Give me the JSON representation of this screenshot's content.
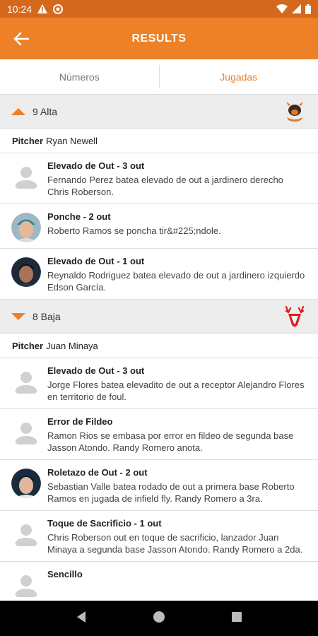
{
  "status": {
    "time": "10:24"
  },
  "app_bar": {
    "title": "RESULTS"
  },
  "tabs": [
    {
      "label": "Números",
      "active": false
    },
    {
      "label": "Jugadas",
      "active": true
    }
  ],
  "innings": [
    {
      "label": "9 Alta",
      "direction": "up",
      "pitcher_label": "Pitcher",
      "pitcher": "Ryan Newell",
      "plays": [
        {
          "title": "Elevado de Out - 3 out",
          "desc": "Fernando Perez batea elevado de out a jardinero derecho Chris Roberson.",
          "avatar": "placeholder"
        },
        {
          "title": "Ponche - 2 out",
          "desc": "Roberto Ramos se poncha tir&#225;ndole.",
          "avatar": "photo-teal"
        },
        {
          "title": "Elevado de Out - 1 out",
          "desc": "Reynaldo Rodriguez batea elevado de out a jardinero izquierdo Edson García.",
          "avatar": "photo-dark"
        }
      ]
    },
    {
      "label": "8 Baja",
      "direction": "down",
      "pitcher_label": "Pitcher",
      "pitcher": "Juan Minaya",
      "plays": [
        {
          "title": "Elevado de Out - 3 out",
          "desc": "Jorge Flores batea elevadito de out a receptor Alejandro Flores en territorio de foul.",
          "avatar": "placeholder"
        },
        {
          "title": "Error de Fildeo",
          "desc": "Ramon Rios se embasa por error en fildeo de segunda base Jasson Atondo.   Randy Romero anota.",
          "avatar": "placeholder"
        },
        {
          "title": "Roletazo de Out - 2 out",
          "desc": "Sebastian Valle batea rodado de out a primera base Roberto Ramos en jugada de infield fly.   Randy Romero a 3ra.",
          "avatar": "photo-navy"
        },
        {
          "title": "Toque de Sacrificio - 1 out",
          "desc": "Chris Roberson out en toque de sacrificio, lanzador Juan Minaya a segunda base Jasson Atondo.   Randy Romero a 2da.",
          "avatar": "placeholder"
        },
        {
          "title": "Sencillo",
          "desc": "",
          "avatar": "placeholder"
        }
      ]
    }
  ],
  "colors": {
    "accent": "#ee8027",
    "status_bar": "#d4691e"
  }
}
